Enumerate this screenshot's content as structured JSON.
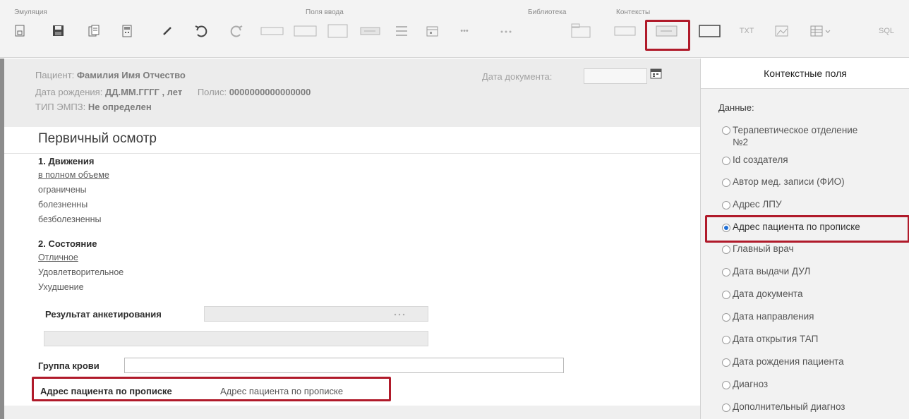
{
  "toolbar": {
    "groups": {
      "emulation": "Эмуляция",
      "input_fields": "Поля ввода",
      "library": "Библиотека",
      "contexts": "Контексты"
    },
    "buttons": {
      "txt": "TXT",
      "sql": "SQL",
      "bullets": "•••"
    }
  },
  "patient": {
    "label_patient": "Пациент:",
    "name": "Фамилия Имя Отчество",
    "label_birth": "Дата рождения:",
    "birth": "ДД.ММ.ГГГГ , лет",
    "label_policy": "Полис:",
    "policy": "0000000000000000",
    "label_type": "ТИП ЭМПЗ:",
    "type": "Не определен",
    "doc_date_label": "Дата документа:"
  },
  "form": {
    "title": "Первичный осмотр",
    "section1": {
      "title": "1. Движения",
      "options": [
        "в полном объеме",
        "ограничены",
        "болезненны",
        "безболезненны"
      ]
    },
    "section2": {
      "title": "2. Состояние",
      "options": [
        "Отличное",
        "Удовлетворительное",
        "Ухудшение"
      ]
    },
    "survey_label": "Результат анкетирования",
    "blood_label": "Группа крови",
    "address_label": "Адрес пациента по прописке",
    "address_value": "Адрес пациента по прописке"
  },
  "panel": {
    "header": "Контекстные поля",
    "subtitle": "Данные:",
    "items": [
      {
        "label": "Терапевтическое отделение",
        "label2": "№2",
        "selected": false
      },
      {
        "label": "Id создателя",
        "selected": false
      },
      {
        "label": "Автор мед. записи (ФИО)",
        "selected": false
      },
      {
        "label": "Адрес ЛПУ",
        "selected": false
      },
      {
        "label": "Адрес пациента по прописке",
        "selected": true
      },
      {
        "label": "Главный врач",
        "selected": false
      },
      {
        "label": "Дата выдачи ДУЛ",
        "selected": false
      },
      {
        "label": "Дата документа",
        "selected": false
      },
      {
        "label": "Дата направления",
        "selected": false
      },
      {
        "label": "Дата открытия ТАП",
        "selected": false
      },
      {
        "label": "Дата рождения пациента",
        "selected": false
      },
      {
        "label": "Диагноз",
        "selected": false
      },
      {
        "label": "Дополнительный диагноз",
        "selected": false
      }
    ]
  },
  "colors": {
    "highlight": "#b01a2a",
    "radio_selected": "#1e6fd6"
  }
}
